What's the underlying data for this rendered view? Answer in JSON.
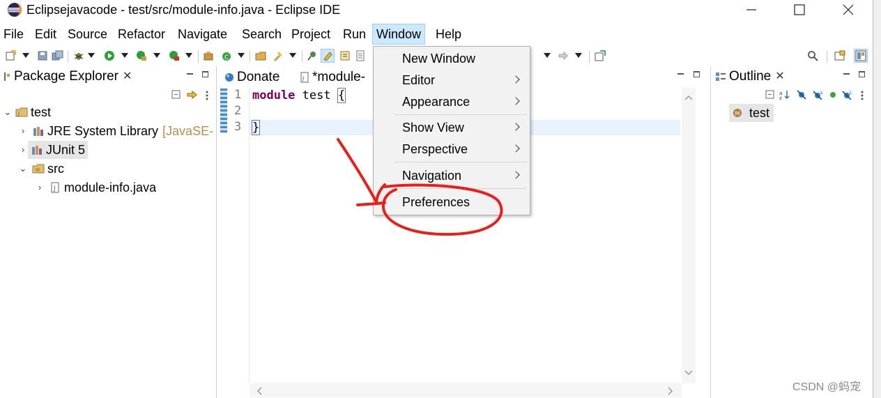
{
  "window": {
    "title": "Eclipsejavacode - test/src/module-info.java - Eclipse IDE",
    "minimize_icon": "minimize-icon",
    "maximize_icon": "maximize-icon",
    "close_icon": "close-icon"
  },
  "menubar": {
    "items": [
      "File",
      "Edit",
      "Source",
      "Refactor",
      "Navigate",
      "Search",
      "Project",
      "Run",
      "Window",
      "Help"
    ],
    "active": "Window"
  },
  "window_menu": {
    "items": [
      {
        "label": "New Window",
        "submenu": false
      },
      {
        "label": "Editor",
        "submenu": true
      },
      {
        "label": "Appearance",
        "submenu": true
      },
      {
        "label": "Show View",
        "submenu": true
      },
      {
        "label": "Perspective",
        "submenu": true
      },
      {
        "label": "Navigation",
        "submenu": true
      },
      {
        "label": "Preferences",
        "submenu": false
      }
    ]
  },
  "package_explorer": {
    "tab_label": "Package Explorer",
    "tree": [
      {
        "label": "test",
        "icon": "project-icon",
        "expanded": true
      },
      {
        "label": "JRE System Library",
        "decoration": "[JavaSE-",
        "icon": "library-icon",
        "expanded": false
      },
      {
        "label": "JUnit 5",
        "icon": "library-icon",
        "expanded": false,
        "selected": true
      },
      {
        "label": "src",
        "icon": "source-folder-icon",
        "expanded": true
      },
      {
        "label": "module-info.java",
        "icon": "java-file-icon",
        "expanded": false
      }
    ]
  },
  "editor": {
    "tabs": [
      {
        "label": "Donate",
        "icon": "globe-icon"
      },
      {
        "label": "*module-",
        "icon": "java-file-icon",
        "active": true
      }
    ],
    "line_numbers": [
      "1",
      "2",
      "3"
    ],
    "code": {
      "line1_keyword": "module",
      "line1_name": "test",
      "line1_brace": "{",
      "line3": "}"
    }
  },
  "outline": {
    "tab_label": "Outline",
    "item": "test",
    "item_icon": "module-icon"
  },
  "watermark": "CSDN @蚂宠",
  "colors": {
    "menu_active_bg": "#cce8ff",
    "keyword": "#7f0055",
    "annotation": "#e8201a",
    "current_line": "#e8f2fe"
  }
}
